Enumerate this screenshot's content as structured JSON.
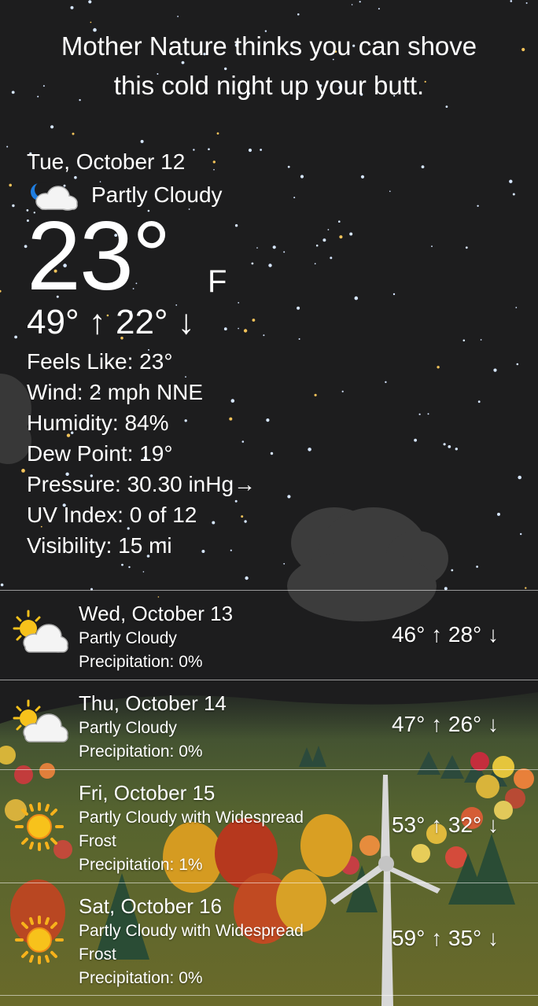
{
  "header": {
    "tagline_line1": "Mother Nature thinks you can shove",
    "tagline_line2": "this cold night up your butt."
  },
  "current": {
    "date": "Tue, October 12",
    "condition": "Partly Cloudy",
    "condition_icon": "moon-cloud-icon",
    "temperature": "23°",
    "unit": "F",
    "hilo": "49° ↑ 22° ↓",
    "details": [
      "Feels Like:  23°",
      "Wind:  2 mph NNE",
      "Humidity:  84%",
      "Dew Point:  19°",
      "Pressure:  30.30 inHg→",
      "UV Index:  0 of 12",
      "Visibility:  15 mi"
    ]
  },
  "forecast": [
    {
      "day": "Wed, October 13",
      "condition": "Partly Cloudy",
      "precip": "Precipitation:  0%",
      "hilo": "46° ↑  28° ↓",
      "icon": "sun-cloud-icon"
    },
    {
      "day": "Thu, October 14",
      "condition": "Partly Cloudy",
      "precip": "Precipitation:  0%",
      "hilo": "47° ↑  26° ↓",
      "icon": "sun-cloud-icon"
    },
    {
      "day": "Fri, October 15",
      "condition": "Partly Cloudy with Widespread Frost",
      "precip": "Precipitation:  1%",
      "hilo": "53° ↑  32° ↓",
      "icon": "sun-icon"
    },
    {
      "day": "Sat, October 16",
      "condition": "Partly Cloudy with Widespread Frost",
      "precip": "Precipitation:  0%",
      "hilo": "59° ↑  35° ↓",
      "icon": "sun-icon"
    }
  ],
  "colors": {
    "sky": "#1d1d1e",
    "grass": "#4f5a2e",
    "sun": "#f7c21b",
    "cloud": "#f4f4f4"
  }
}
